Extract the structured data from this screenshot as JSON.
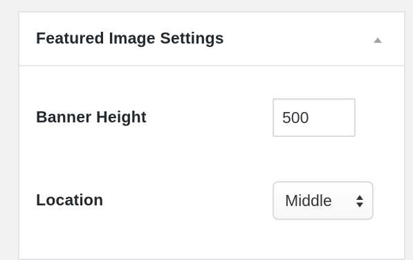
{
  "metabox": {
    "title": "Featured Image Settings",
    "toggle_icon": "triangle-up-icon"
  },
  "fields": {
    "banner_height": {
      "label": "Banner Height",
      "value": "500"
    },
    "location": {
      "label": "Location",
      "selected": "Middle",
      "icon": "select-arrows-icon"
    }
  },
  "colors": {
    "page_background": "#f1f1f1",
    "panel_background": "#ffffff",
    "text": "#23282d",
    "border": "#dcdcde",
    "toggle_icon": "#a0a5aa"
  }
}
